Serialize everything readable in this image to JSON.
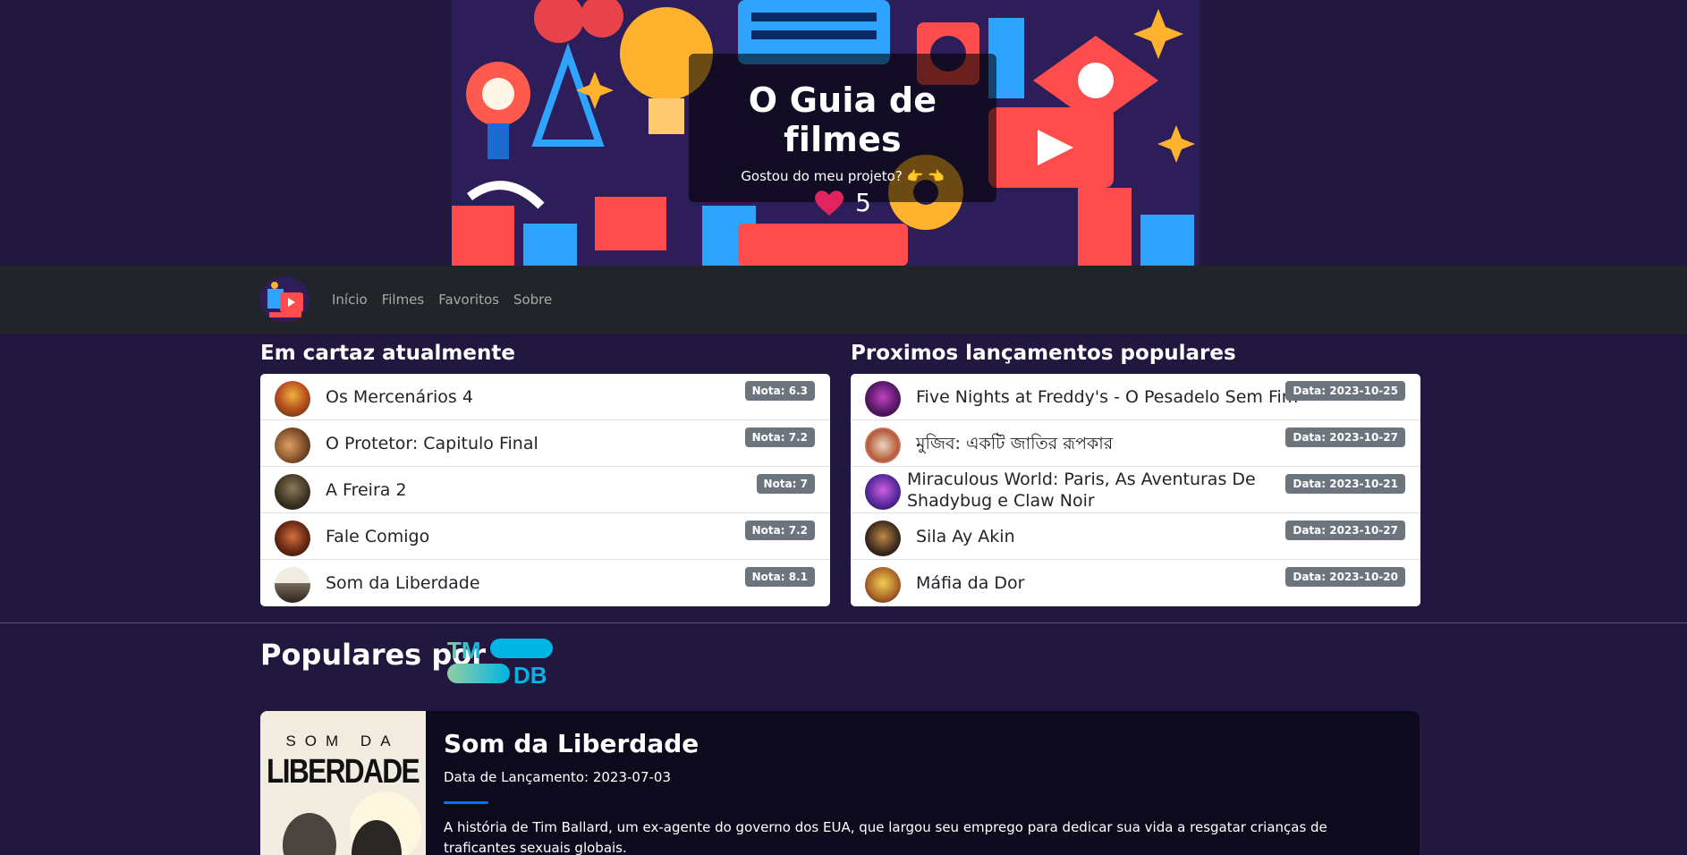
{
  "hero": {
    "title": "O Guia de filmes",
    "subtitle": "Gostou do meu projeto? 👉 👈",
    "likes": "5"
  },
  "nav": {
    "links": [
      "Início",
      "Filmes",
      "Favoritos",
      "Sobre"
    ]
  },
  "now_playing": {
    "title": "Em cartaz atualmente",
    "items": [
      {
        "title": "Os Mercenários 4",
        "badge": "Nota: 6.3"
      },
      {
        "title": "O Protetor: Capitulo Final",
        "badge": "Nota: 7.2"
      },
      {
        "title": "A Freira 2",
        "badge": "Nota: 7"
      },
      {
        "title": "Fale Comigo",
        "badge": "Nota: 7.2"
      },
      {
        "title": "Som da Liberdade",
        "badge": "Nota: 8.1"
      }
    ]
  },
  "upcoming": {
    "title": "Proximos lançamentos populares",
    "items": [
      {
        "title": "Five Nights at Freddy's - O Pesadelo Sem Fim",
        "badge": "Data: 2023-10-25"
      },
      {
        "title": "মুজিব: একটি জাতির রূপকার",
        "badge": "Data: 2023-10-27"
      },
      {
        "title": "Miraculous World: Paris, As Aventuras De Shadybug e Claw Noir",
        "badge": "Data: 2023-10-21"
      },
      {
        "title": "Sila Ay Akin",
        "badge": "Data: 2023-10-27"
      },
      {
        "title": "Máfia da Dor",
        "badge": "Data: 2023-10-20"
      }
    ]
  },
  "popular": {
    "title": "Populares por",
    "logo_top": "TM",
    "logo_bottom": "DB",
    "feature": {
      "poster_top": "SOM DA",
      "poster_bottom": "LIBERDADE",
      "title": "Som da Liberdade",
      "date": "Data de Lançamento: 2023-07-03",
      "description": "A história de Tim Ballard, um ex-agente do governo dos EUA, que largou seu emprego para dedicar sua vida a resgatar crianças de traficantes sexuais globais."
    }
  },
  "colors": {
    "background": "#22173f",
    "navbar": "#212529",
    "badge": "#6c757d",
    "accent": "#0d6efd",
    "heart": "#e0245e"
  }
}
